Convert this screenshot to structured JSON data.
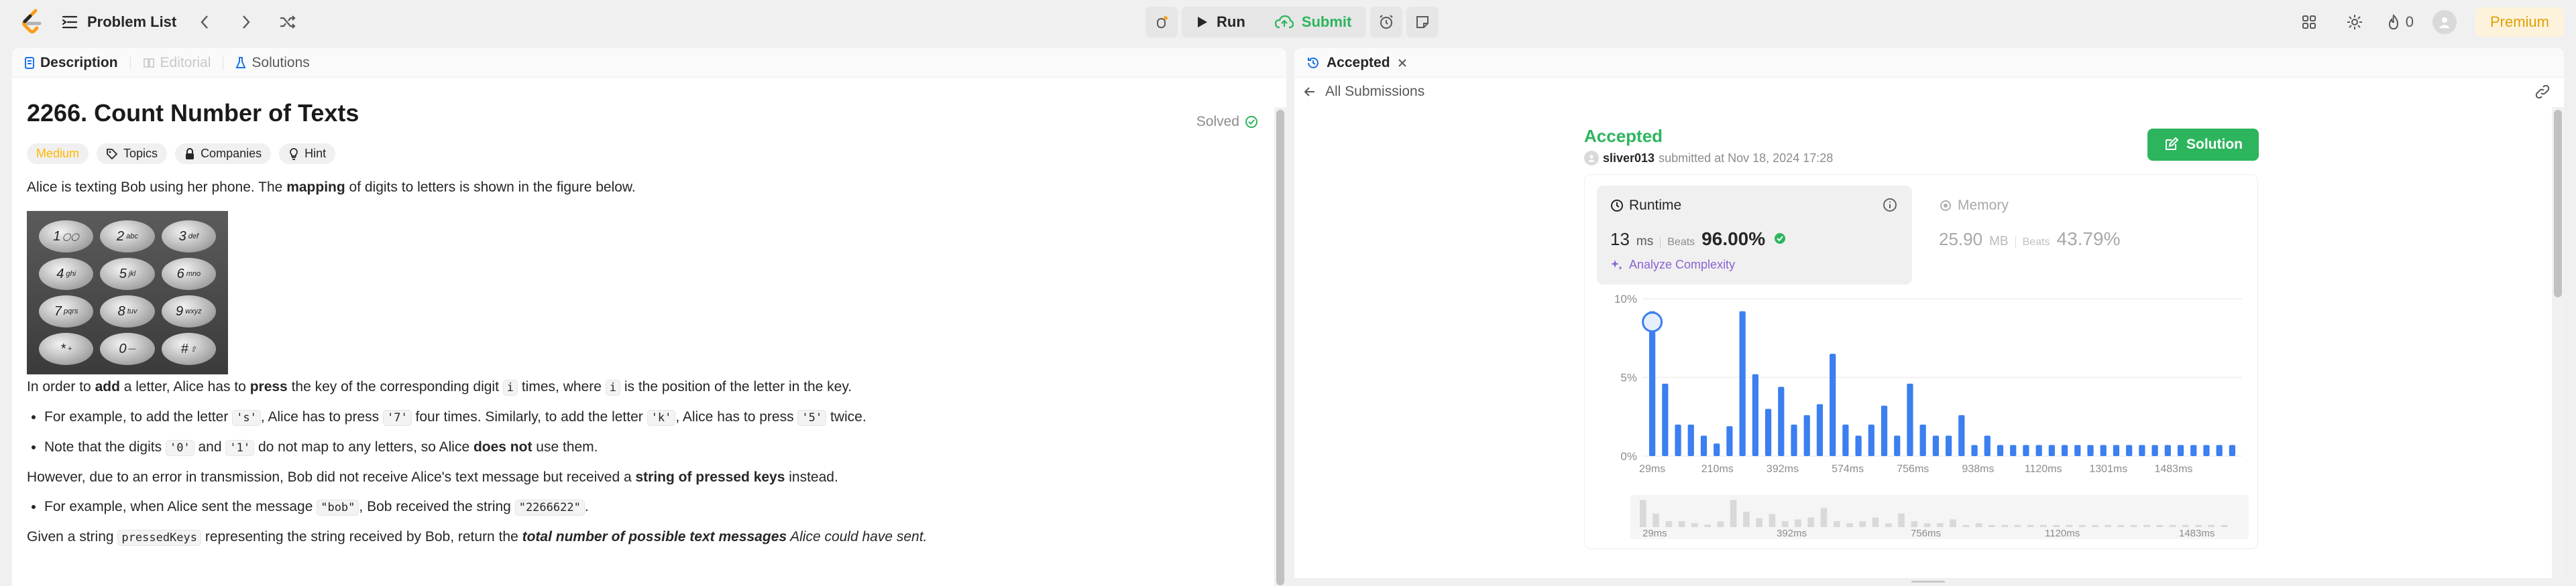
{
  "nav": {
    "title": "Problem List",
    "run_label": "Run",
    "submit_label": "Submit",
    "fire_count": "0",
    "premium_label": "Premium"
  },
  "left": {
    "tabs": [
      "Description",
      "Editorial",
      "Solutions"
    ],
    "problem_title": "2266. Count Number of Texts",
    "solved_label": "Solved",
    "chips": [
      "Medium",
      "Topics",
      "Companies",
      "Hint"
    ],
    "p1_a": "Alice is texting Bob using her phone. The ",
    "p1_b": "mapping",
    "p1_c": " of digits to letters is shown in the figure below.",
    "keypad": [
      {
        "d": "1",
        "l": "◯◯"
      },
      {
        "d": "2",
        "l": "abc"
      },
      {
        "d": "3",
        "l": "def"
      },
      {
        "d": "4",
        "l": "ghi"
      },
      {
        "d": "5",
        "l": "jkl"
      },
      {
        "d": "6",
        "l": "mno"
      },
      {
        "d": "7",
        "l": "pqrs"
      },
      {
        "d": "8",
        "l": "tuv"
      },
      {
        "d": "9",
        "l": "wxyz"
      },
      {
        "d": "*",
        "l": "+"
      },
      {
        "d": "0",
        "l": "—"
      },
      {
        "d": "#",
        "l": "⇧"
      }
    ],
    "p2_a": "In order to ",
    "p2_b": "add",
    "p2_c": " a letter, Alice has to ",
    "p2_d": "press",
    "p2_e": " the key of the corresponding digit ",
    "p2_f": "i",
    "p2_g": " times, where ",
    "p2_h": "i",
    "p2_i": " is the position of the letter in the key.",
    "b1_a": "For example, to add the letter ",
    "b1_b": "'s'",
    "b1_c": ", Alice has to press ",
    "b1_d": "'7'",
    "b1_e": " four times. Similarly, to add the letter ",
    "b1_f": "'k'",
    "b1_g": ", Alice has to press ",
    "b1_h": "'5'",
    "b1_i": " twice.",
    "b2_a": "Note that the digits ",
    "b2_b": "'0'",
    "b2_c": " and ",
    "b2_d": "'1'",
    "b2_e": " do not map to any letters, so Alice ",
    "b2_f": "does not",
    "b2_g": " use them.",
    "p3_a": "However, due to an error in transmission, Bob did not receive Alice's text message but received a ",
    "p3_b": "string of pressed keys",
    "p3_c": " instead.",
    "b3_a": "For example, when Alice sent the message ",
    "b3_b": "\"bob\"",
    "b3_c": ", Bob received the string ",
    "b3_d": "\"2266622\"",
    "b3_e": ".",
    "p4_a": "Given a string ",
    "p4_b": "pressedKeys",
    "p4_c": " representing the string received by Bob, return the ",
    "p4_d": "total number of possible text messages",
    "p4_e": " Alice could have sent."
  },
  "right": {
    "tab_label": "Accepted",
    "all_submissions": "All Submissions",
    "status": "Accepted",
    "username": "sliver013",
    "submitted_text": "submitted at Nov 18, 2024 17:28",
    "solution_label": "Solution",
    "runtime": {
      "label": "Runtime",
      "value": "13",
      "unit": "ms",
      "beats_label": "Beats",
      "beats": "96.00%"
    },
    "analyze_label": "Analyze Complexity",
    "memory": {
      "label": "Memory",
      "value": "25.90",
      "unit": "MB",
      "beats_label": "Beats",
      "beats": "43.79%"
    }
  },
  "colors": {
    "accent_green": "#2db55d",
    "bar_blue": "#3b7ff0",
    "medium": "#ffb800"
  },
  "chart_data": {
    "type": "bar",
    "title": "",
    "xlabel": "",
    "ylabel": "",
    "ylim": [
      0,
      10
    ],
    "yticks": [
      "0%",
      "5%",
      "10%"
    ],
    "xticks": [
      "29ms",
      "210ms",
      "392ms",
      "574ms",
      "756ms",
      "938ms",
      "1120ms",
      "1301ms",
      "1483ms"
    ],
    "values": [
      9.2,
      4.6,
      2.0,
      2.0,
      1.3,
      0.8,
      1.9,
      9.2,
      5.2,
      3.0,
      4.4,
      2.0,
      2.6,
      3.3,
      6.5,
      2.0,
      1.3,
      2.0,
      3.2,
      1.3,
      4.6,
      2.0,
      1.3,
      1.3,
      2.6,
      0.7,
      1.3,
      0.7,
      0.7,
      0.7,
      0.7,
      0.7,
      0.7,
      0.7,
      0.7,
      0.7,
      0.7,
      0.7,
      0.7,
      0.7,
      0.7,
      0.7,
      0.7,
      0.7,
      0.7,
      0.7
    ],
    "highlight_index": 0,
    "overview_xticks": [
      "29ms",
      "392ms",
      "756ms",
      "1120ms",
      "1483ms"
    ]
  }
}
